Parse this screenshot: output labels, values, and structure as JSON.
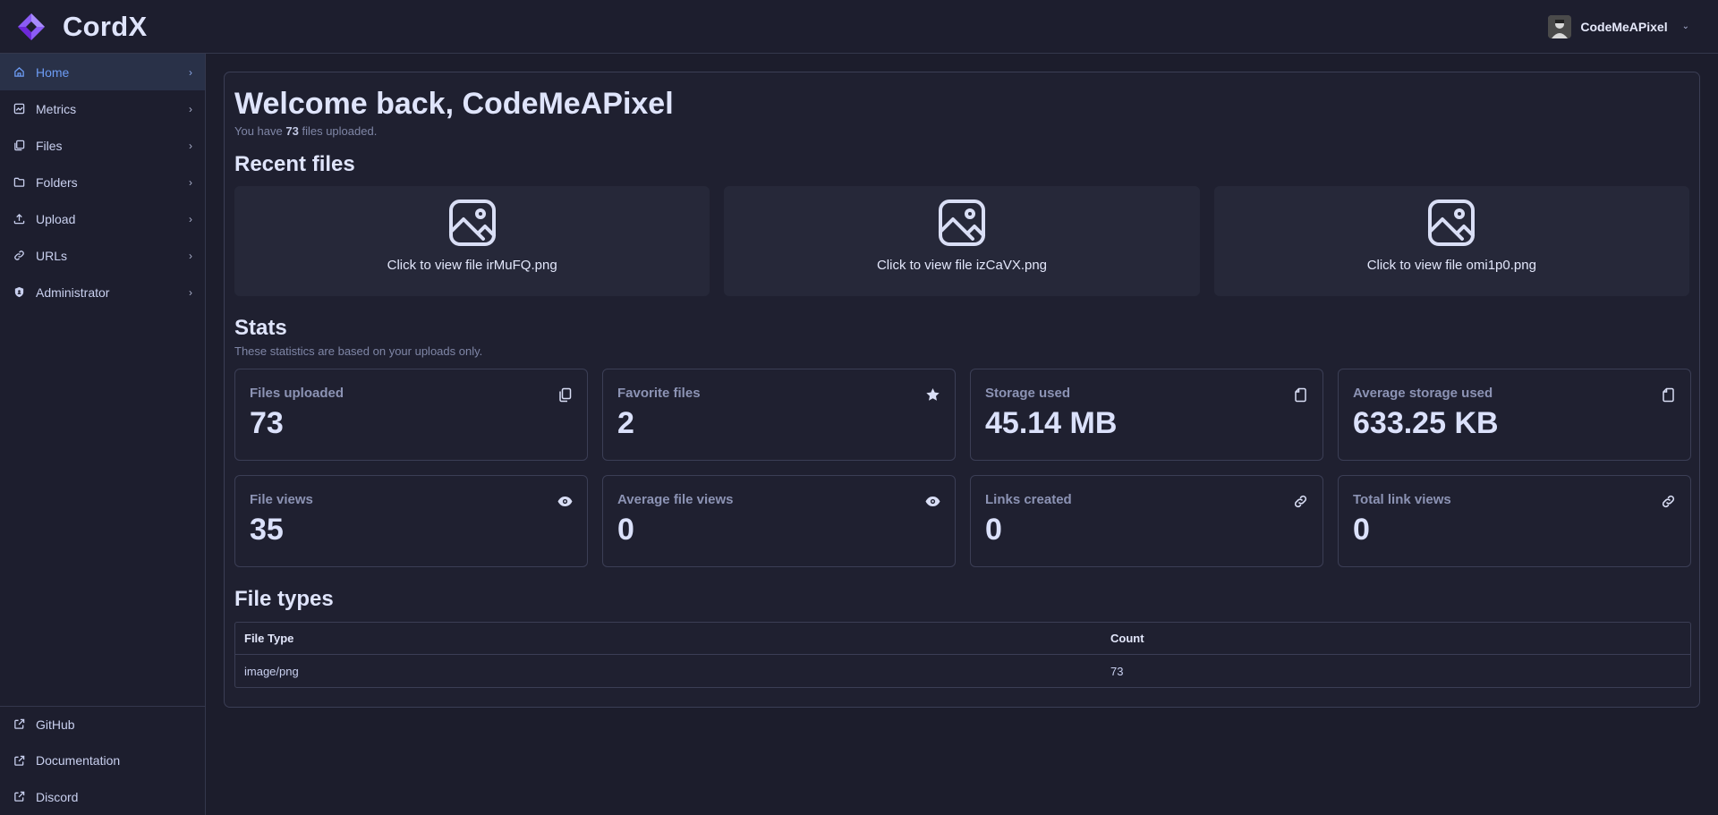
{
  "app": {
    "name": "CordX"
  },
  "user": {
    "name": "CodeMeAPixel"
  },
  "sidebar": {
    "items": [
      {
        "label": "Home",
        "icon": "home-icon",
        "active": true
      },
      {
        "label": "Metrics",
        "icon": "chart-icon"
      },
      {
        "label": "Files",
        "icon": "files-icon"
      },
      {
        "label": "Folders",
        "icon": "folder-icon"
      },
      {
        "label": "Upload",
        "icon": "upload-icon"
      },
      {
        "label": "URLs",
        "icon": "link-icon"
      },
      {
        "label": "Administrator",
        "icon": "shield-icon"
      }
    ],
    "bottom": [
      {
        "label": "GitHub",
        "icon": "external-link-icon"
      },
      {
        "label": "Documentation",
        "icon": "external-link-icon"
      },
      {
        "label": "Discord",
        "icon": "external-link-icon"
      }
    ]
  },
  "welcome": {
    "title": "Welcome back, CodeMeAPixel",
    "sub_prefix": "You have",
    "file_count": "73",
    "sub_suffix": "files uploaded."
  },
  "recent": {
    "title": "Recent files",
    "files": [
      {
        "label": "Click to view file irMuFQ.png"
      },
      {
        "label": "Click to view file izCaVX.png"
      },
      {
        "label": "Click to view file omi1p0.png"
      }
    ]
  },
  "stats": {
    "title": "Stats",
    "subtitle": "These statistics are based on your uploads only.",
    "cards": [
      {
        "label": "Files uploaded",
        "value": "73",
        "icon": "copy-icon"
      },
      {
        "label": "Favorite files",
        "value": "2",
        "icon": "star-icon"
      },
      {
        "label": "Storage used",
        "value": "45.14 MB",
        "icon": "file-icon"
      },
      {
        "label": "Average storage used",
        "value": "633.25 KB",
        "icon": "file-icon"
      },
      {
        "label": "File views",
        "value": "35",
        "icon": "eye-icon"
      },
      {
        "label": "Average file views",
        "value": "0",
        "icon": "eye-icon"
      },
      {
        "label": "Links created",
        "value": "0",
        "icon": "link-icon"
      },
      {
        "label": "Total link views",
        "value": "0",
        "icon": "link-icon"
      }
    ]
  },
  "file_types": {
    "title": "File types",
    "headers": [
      "File Type",
      "Count"
    ],
    "rows": [
      [
        "image/png",
        "73"
      ]
    ]
  },
  "colors": {
    "background": "#1c1d2c",
    "panel": "#1f2030",
    "accent": "#6d9cf4",
    "logo": "#8b5cf6"
  }
}
